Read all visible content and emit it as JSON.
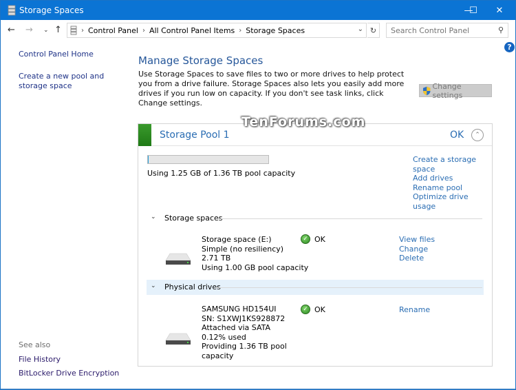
{
  "window": {
    "title": "Storage Spaces",
    "controls": {
      "minimize": "—",
      "maximize": "☐",
      "close": "✕"
    }
  },
  "nav": {
    "back": "←",
    "forward": "→",
    "recent": "⌄",
    "up": "↑",
    "breadcrumbs": [
      "Control Panel",
      "All Control Panel Items",
      "Storage Spaces"
    ],
    "separator": "›",
    "refresh": "↻",
    "search_placeholder": "Search Control Panel",
    "search_icon": "⚲"
  },
  "sidebar": {
    "home": "Control Panel Home",
    "create_pool": "Create a new pool and storage space",
    "see_also_label": "See also",
    "see_also": [
      "File History",
      "BitLocker Drive Encryption"
    ]
  },
  "help_icon": "?",
  "main": {
    "title": "Manage Storage Spaces",
    "description": "Use Storage Spaces to save files to two or more drives to help protect you from a drive failure. Storage Spaces also lets you easily add more drives if you run low on capacity. If you don't see task links, click Change settings.",
    "change_settings": "Change settings"
  },
  "watermark": "TenForums.com",
  "pool": {
    "name": "Storage Pool 1",
    "status": "OK",
    "status_color": "#2c8a21",
    "usage_fraction": 0.0009,
    "usage_text": "Using 1.25 GB of 1.36 TB pool capacity",
    "links": [
      "Create a storage space",
      "Add drives",
      "Rename pool",
      "Optimize drive usage"
    ],
    "storage_spaces_label": "Storage spaces",
    "physical_drives_label": "Physical drives",
    "spaces": [
      {
        "lines": [
          "Storage space (E:)",
          "Simple (no resiliency)",
          "2.71 TB",
          "Using 1.00 GB pool capacity"
        ],
        "status": "OK",
        "links": [
          "View files",
          "Change",
          "Delete"
        ]
      }
    ],
    "drives": [
      {
        "lines": [
          "SAMSUNG HD154UI",
          "SN: S1XWJ1KS928872",
          "Attached via SATA",
          "0.12% used",
          "Providing 1.36 TB pool capacity"
        ],
        "status": "OK",
        "links": [
          "Rename"
        ]
      }
    ]
  }
}
